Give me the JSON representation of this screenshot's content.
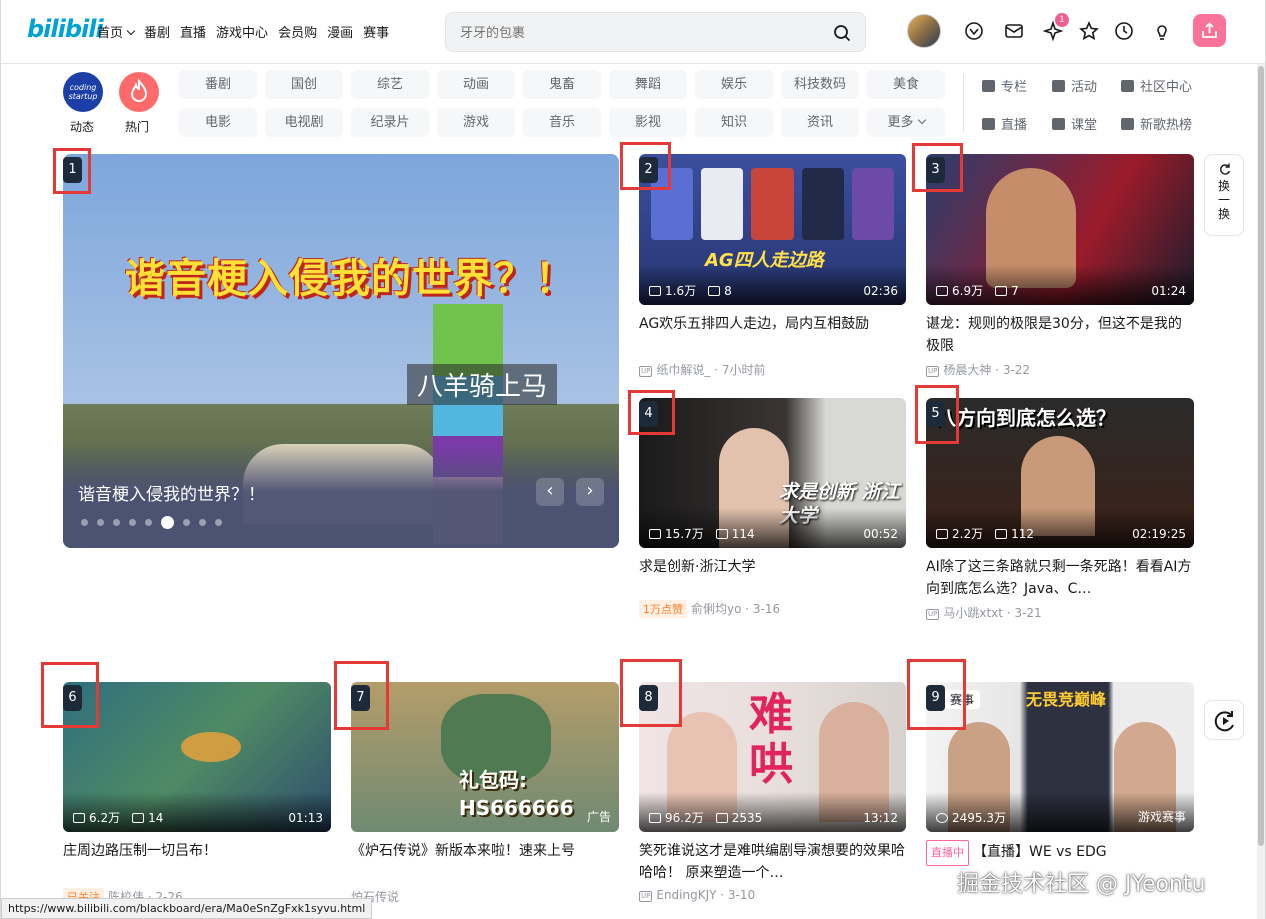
{
  "header": {
    "logo": "bilibili",
    "nav": [
      "首页",
      "番剧",
      "直播",
      "游戏中心",
      "会员购",
      "漫画",
      "赛事"
    ],
    "search_placeholder": "牙牙的包裹",
    "notification_count": "1"
  },
  "channels": {
    "dynamic_label": "动态",
    "dynamic_badge": "coding startup",
    "hot_label": "热门",
    "grid": [
      "番剧",
      "国创",
      "综艺",
      "动画",
      "鬼畜",
      "舞蹈",
      "娱乐",
      "科技数码",
      "美食",
      "电影",
      "电视剧",
      "纪录片",
      "游戏",
      "音乐",
      "影视",
      "知识",
      "资讯",
      "更多"
    ],
    "right_links": [
      "专栏",
      "活动",
      "社区中心",
      "直播",
      "课堂",
      "新歌热榜"
    ]
  },
  "hero": {
    "banner_text": "谐音梗入侵我的世界？！",
    "overlay_text": "八羊骑上马",
    "title": "谐音梗入侵我的世界？！",
    "prev": "‹",
    "next": "›",
    "slide_count": 9,
    "active_slide": 6
  },
  "videos": [
    {
      "num": "1"
    },
    {
      "num": "2",
      "views": "1.6万",
      "danmaku": "8",
      "duration": "02:36",
      "thumb_text": "AG四人走边路",
      "title": "AG欢乐五排四人走边，局内互相鼓励",
      "uploader": "纸巾解说_",
      "date": "7小时前"
    },
    {
      "num": "3",
      "views": "6.9万",
      "danmaku": "7",
      "duration": "01:24",
      "title": "谌龙：规则的极限是30分，但这不是我的极限",
      "uploader": "杨晨大神",
      "date": "3-22"
    },
    {
      "num": "4",
      "views": "15.7万",
      "danmaku": "114",
      "duration": "00:52",
      "thumb_text": "求是创新 浙江大学",
      "title": "求是创新·浙江大学",
      "tag": "1万点赞",
      "uploader": "俞俐均yo",
      "date": "3-16"
    },
    {
      "num": "5",
      "views": "2.2万",
      "danmaku": "112",
      "duration": "02:19:25",
      "thumb_text": "八方向到底怎么选？",
      "title": "AI除了这三条路就只剩一条死路！看看AI方向到底怎么选？Java、C…",
      "uploader": "马小跳xtxt",
      "date": "3-21"
    },
    {
      "num": "6",
      "views": "6.2万",
      "danmaku": "14",
      "duration": "01:13",
      "title": "庄周边路压制一切吕布！",
      "tag": "已关注",
      "uploader": "陈校伟",
      "date": "2-26"
    },
    {
      "num": "7",
      "ad_label": "广告",
      "thumb_text": "礼包码: HS666666",
      "title": "《炉石传说》新版本来啦！速来上号",
      "uploader": "炉石传说"
    },
    {
      "num": "8",
      "views": "96.2万",
      "danmaku": "2535",
      "duration": "13:12",
      "thumb_text": "难哄",
      "title": "笑死谁说这才是难哄编剧导演想要的效果哈哈哈！ 原来塑造一个…",
      "uploader": "EndingKJY",
      "date": "3-10"
    },
    {
      "num": "9",
      "badge": "赛事",
      "views": "2495.3万",
      "category": "游戏赛事",
      "thumb_text": "无畏竞巅峰",
      "tag": "直播中",
      "title": "【直播】WE vs EDG"
    }
  ],
  "refresh_label": "换一换",
  "status_url": "https://www.bilibili.com/blackboard/era/Ma0eSnZgFxk1syvu.html",
  "watermark": "掘金技术社区 @ JYeontu",
  "colors": {
    "brand": "#00a1d6",
    "pink": "#fb7299",
    "highlight": "#e53935"
  }
}
